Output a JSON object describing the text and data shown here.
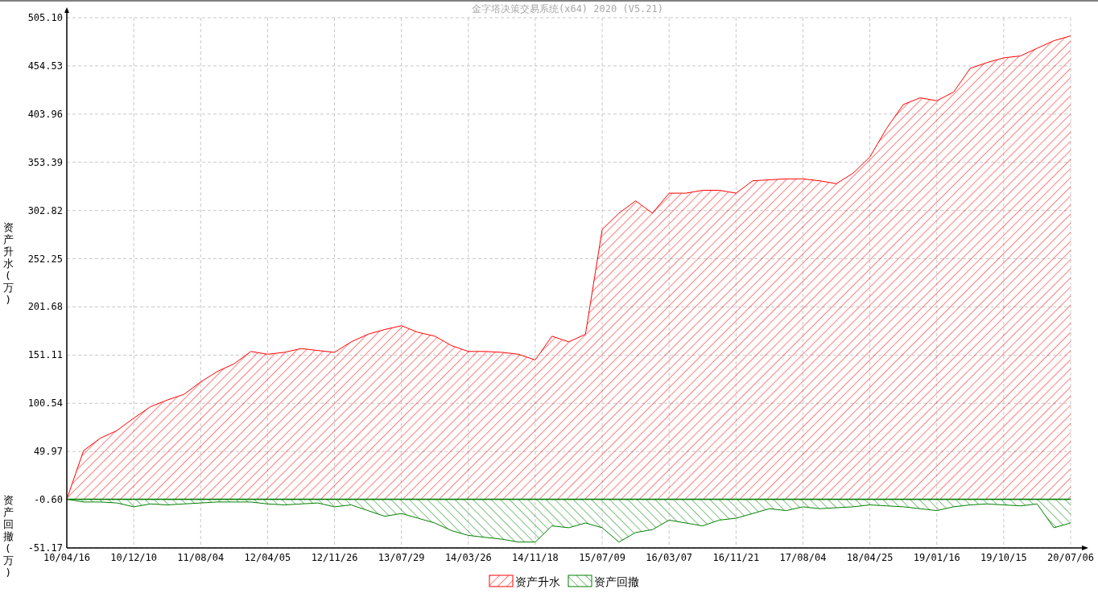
{
  "chart": {
    "chart_data": {
      "type": "area",
      "title": "金字塔决策交易系统(x64) 2020 (V5.21)",
      "ylabel": "资产升水(万)",
      "categories": [
        "10/04/16",
        null,
        null,
        null,
        "10/12/10",
        null,
        null,
        null,
        "11/08/04",
        null,
        null,
        null,
        "12/04/05",
        null,
        null,
        null,
        "12/11/26",
        null,
        null,
        null,
        "13/07/29",
        null,
        null,
        null,
        "14/03/26",
        null,
        null,
        null,
        "14/11/18",
        null,
        null,
        null,
        "15/07/09",
        null,
        null,
        null,
        "16/03/07",
        null,
        null,
        null,
        "16/11/21",
        null,
        null,
        null,
        "17/08/04",
        null,
        null,
        null,
        "18/04/25",
        null,
        null,
        null,
        "19/01/16",
        null,
        null,
        null,
        "19/10/15",
        null,
        null,
        null,
        "20/07/06"
      ],
      "series": [
        {
          "name": "资产升水",
          "color": "#ff0000",
          "values": [
            0,
            51,
            64,
            72,
            85,
            97,
            104,
            110,
            123,
            134,
            142,
            155,
            152,
            154,
            158,
            156,
            154,
            165,
            173,
            178,
            182,
            175,
            171,
            161,
            155,
            155,
            154,
            152,
            146,
            171,
            165,
            173,
            283,
            300,
            313,
            300,
            321,
            321,
            324,
            324,
            321,
            334,
            335,
            336,
            336,
            334,
            331,
            342,
            359,
            389,
            414,
            421,
            418,
            427,
            452,
            458,
            463,
            465,
            473,
            481,
            486
          ]
        },
        {
          "name": "资产回撤",
          "color": "#008000",
          "values": [
            0,
            -3,
            -3,
            -4,
            -8,
            -5,
            -6,
            -5,
            -4,
            -3,
            -3,
            -3,
            -5,
            -6,
            -5,
            -4,
            -8,
            -6,
            -12,
            -18,
            -15,
            -20,
            -25,
            -33,
            -38,
            -40,
            -42,
            -45,
            -45,
            -28,
            -30,
            -25,
            -30,
            -45,
            -35,
            -32,
            -22,
            -25,
            -28,
            -22,
            -20,
            -15,
            -10,
            -12,
            -8,
            -10,
            -9,
            -8,
            -6,
            -7,
            -8,
            -10,
            -12,
            -8,
            -6,
            -5,
            -6,
            -7,
            -5,
            -30,
            -25
          ]
        }
      ],
      "ylim": [
        -51.17,
        505.1
      ],
      "grid": true,
      "legend": true,
      "ref_lines": [
        {
          "axis": "y",
          "value": 0,
          "color": "#008000"
        }
      ],
      "yticks": [
        {
          "value": 505.1,
          "label": "505.10"
        },
        {
          "value": 454.53,
          "label": "454.53"
        },
        {
          "value": 403.96,
          "label": "403.96"
        },
        {
          "value": 353.39,
          "label": "353.39"
        },
        {
          "value": 302.82,
          "label": "302.82"
        },
        {
          "value": 252.25,
          "label": "252.25"
        },
        {
          "value": 201.68,
          "label": "201.68"
        },
        {
          "value": 151.11,
          "label": "151.11"
        },
        {
          "value": 100.54,
          "label": "100.54"
        },
        {
          "value": 49.97,
          "label": "49.97"
        },
        {
          "value": -0.6,
          "label": "-0.60"
        },
        {
          "value": -51.17,
          "label": "-51.17"
        }
      ]
    },
    "lower_ylabel": "资产回撤(万)"
  }
}
